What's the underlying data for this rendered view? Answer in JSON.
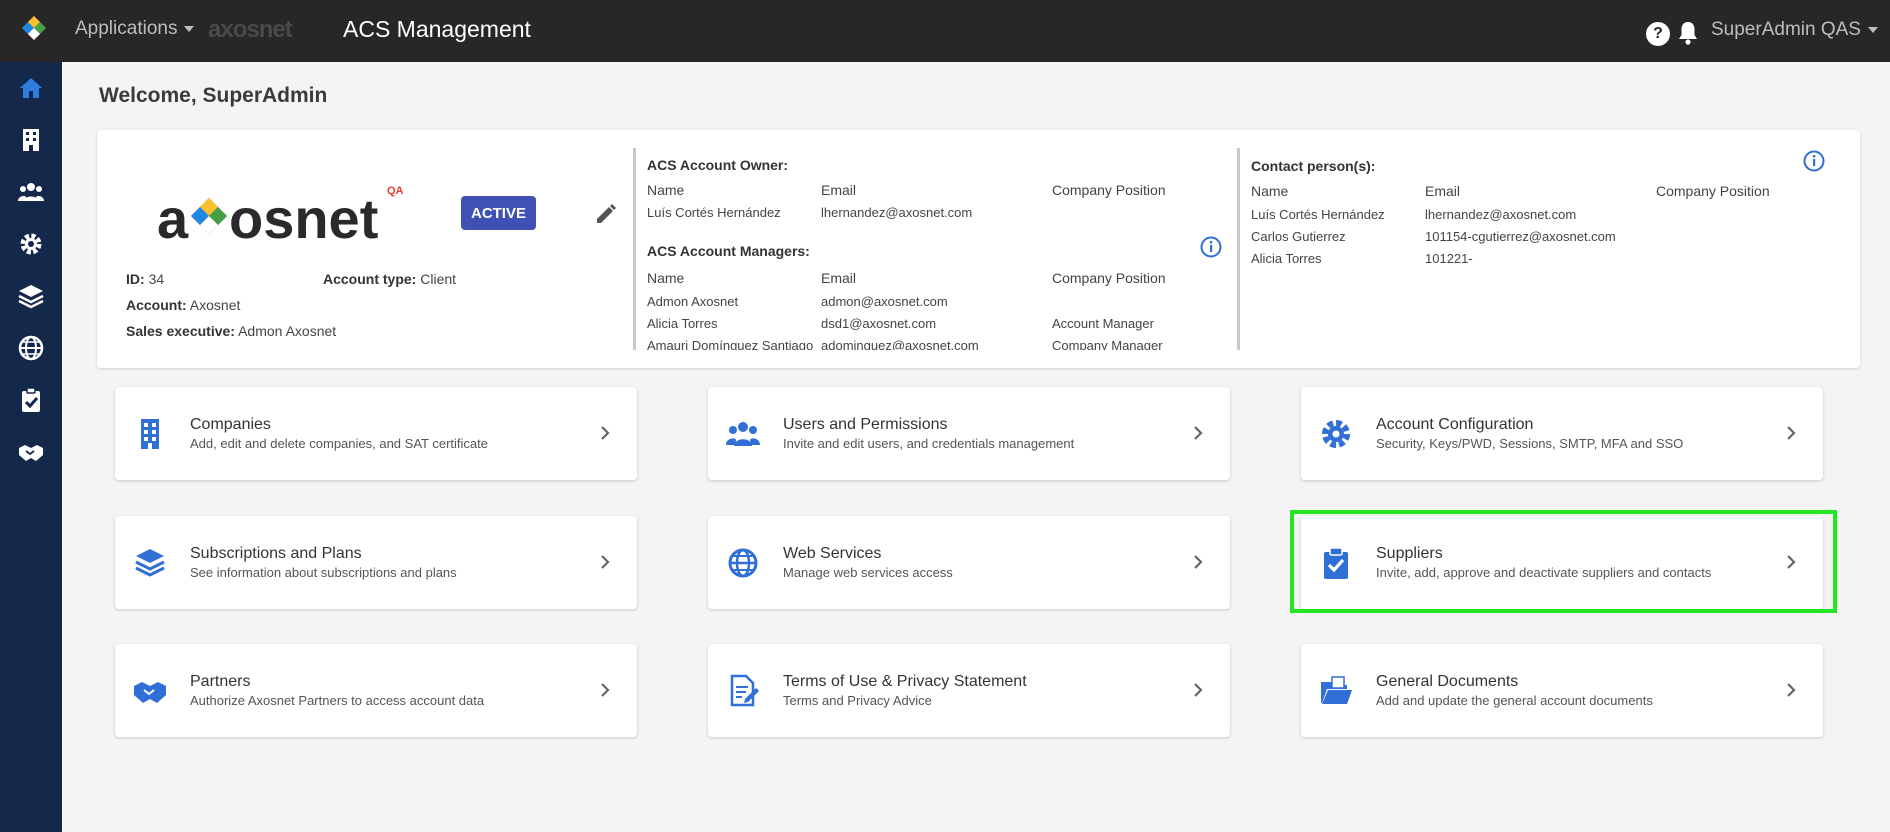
{
  "topbar": {
    "applications_label": "Applications",
    "brand_mini": "axosnet",
    "title": "ACS Management",
    "help_label": "?",
    "user_label": "SuperAdmin QAS"
  },
  "welcome": "Welcome, SuperAdmin",
  "account": {
    "logo_text": "axosnet",
    "logo_tag": "QA",
    "status": "ACTIVE",
    "id_label": "ID:",
    "id_value": "34",
    "type_label": "Account type:",
    "type_value": "Client",
    "account_label": "Account:",
    "account_value": "Axosnet",
    "sales_label": "Sales executive:",
    "sales_value": "Admon Axosnet"
  },
  "owner": {
    "title": "ACS Account Owner:",
    "headers": [
      "Name",
      "Email",
      "Company Position"
    ],
    "rows": [
      [
        "Luís Cortés Hernández",
        "lhernandez@axosnet.com",
        ""
      ]
    ]
  },
  "managers": {
    "title": "ACS Account Managers:",
    "headers": [
      "Name",
      "Email",
      "Company Position"
    ],
    "rows": [
      [
        "Admon Axosnet",
        "admon@axosnet.com",
        ""
      ],
      [
        "Alicia Torres",
        "dsd1@axosnet.com",
        "Account Manager"
      ],
      [
        "Amauri Domínguez Santiago",
        "adominguez@axosnet.com",
        "Company Manager"
      ]
    ]
  },
  "contacts": {
    "title": "Contact person(s):",
    "headers": [
      "Name",
      "Email",
      "Company Position"
    ],
    "rows": [
      [
        "Luís Cortés Hernández",
        "lhernandez@axosnet.com",
        ""
      ],
      [
        "Carlos Gutierrez",
        "101154-cgutierrez@axosnet.com",
        ""
      ],
      [
        "Alicia Torres",
        "101221-",
        ""
      ]
    ]
  },
  "tiles": [
    {
      "title": "Companies",
      "subtitle": "Add, edit and delete companies, and SAT certificate",
      "icon": "building-icon"
    },
    {
      "title": "Users and Permissions",
      "subtitle": "Invite and edit users, and credentials management",
      "icon": "users-icon"
    },
    {
      "title": "Account Configuration",
      "subtitle": "Security, Keys/PWD, Sessions, SMTP, MFA and SSO",
      "icon": "gear-icon"
    },
    {
      "title": "Subscriptions and Plans",
      "subtitle": "See information about subscriptions and plans",
      "icon": "layers-icon"
    },
    {
      "title": "Web Services",
      "subtitle": "Manage web services access",
      "icon": "globe-icon"
    },
    {
      "title": "Suppliers",
      "subtitle": "Invite, add, approve and deactivate suppliers and contacts",
      "icon": "clipboard-check-icon"
    },
    {
      "title": "Partners",
      "subtitle": "Authorize Axosnet Partners to access account data",
      "icon": "handshake-icon"
    },
    {
      "title": "Terms of Use & Privacy Statement",
      "subtitle": "Terms and Privacy Advice",
      "icon": "document-edit-icon"
    },
    {
      "title": "General Documents",
      "subtitle": "Add and update the general account documents",
      "icon": "folder-open-icon"
    }
  ],
  "colors": {
    "accent": "#2f6fd6",
    "sidebar": "#13284b",
    "topbar": "#272727",
    "badge": "#3f51b5",
    "highlight": "#22e622"
  }
}
